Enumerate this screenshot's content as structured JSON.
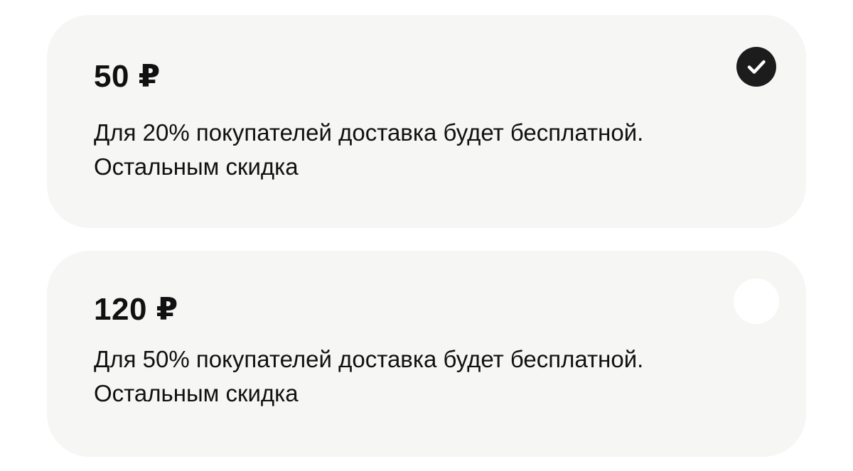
{
  "options": [
    {
      "price": "50 ₽",
      "description_line1": "Для 20% покупателей доставка будет бесплатной.",
      "description_line2": "Остальным скидка",
      "selected": true
    },
    {
      "price": "120 ₽",
      "description_line1": "Для 50% покупателей доставка будет бесплатной.",
      "description_line2": "Остальным скидка",
      "selected": false
    }
  ],
  "colors": {
    "card_background": "#f6f6f5",
    "text": "#111111",
    "radio_checked": "#1c1c1c",
    "radio_unchecked": "#ffffff"
  },
  "icons": {
    "checked": "checkmark-icon"
  }
}
